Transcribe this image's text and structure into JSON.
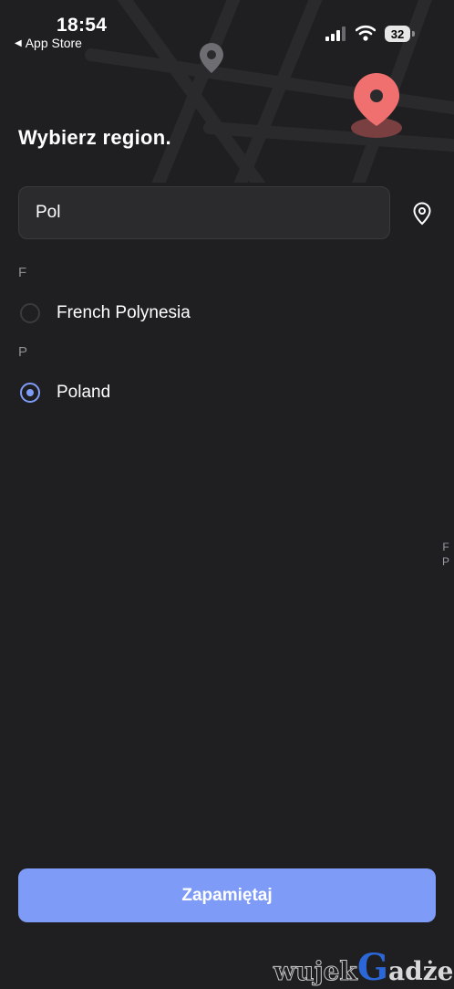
{
  "status_bar": {
    "time": "18:54",
    "back_label": "App Store",
    "battery": "32"
  },
  "page": {
    "title": "Wybierz region."
  },
  "search": {
    "value": "Pol"
  },
  "sections": [
    {
      "letter": "F",
      "items": [
        {
          "label": "French Polynesia",
          "selected": false
        }
      ]
    },
    {
      "letter": "P",
      "items": [
        {
          "label": "Poland",
          "selected": true
        }
      ]
    }
  ],
  "index_bar": [
    "F",
    "P"
  ],
  "footer": {
    "save_label": "Zapamiętaj"
  },
  "watermark": {
    "part1": "wujek",
    "part2": "G",
    "part3": "adżet"
  },
  "colors": {
    "background": "#1f1f21",
    "accent": "#7d9bf7",
    "pin": "#f07070"
  },
  "icons": {
    "map_pin_large": "map-pin-icon",
    "map_pin_small": "map-pin-icon",
    "locate": "location-pin-icon"
  }
}
